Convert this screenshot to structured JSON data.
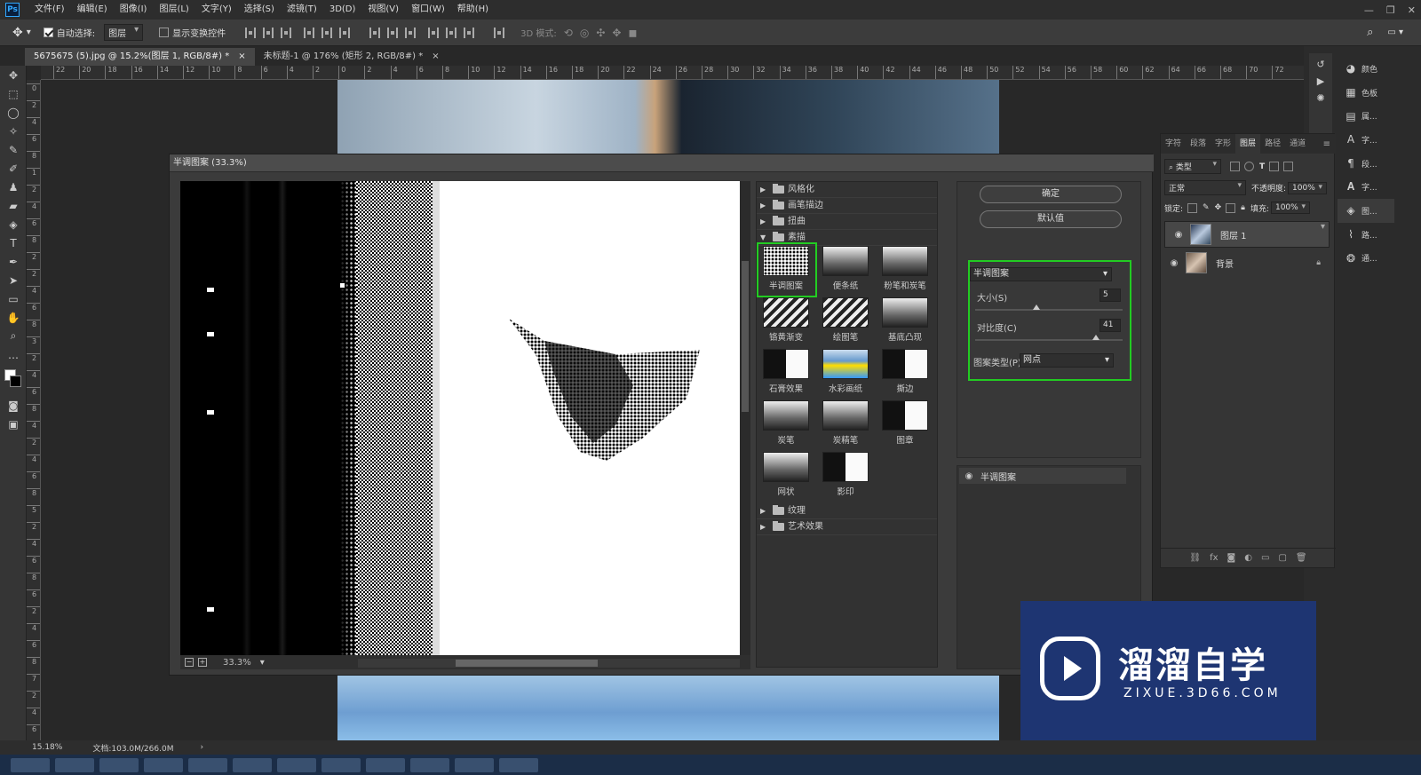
{
  "app": {
    "logo": "Ps"
  },
  "menu": [
    "文件(F)",
    "编辑(E)",
    "图像(I)",
    "图层(L)",
    "文字(Y)",
    "选择(S)",
    "滤镜(T)",
    "3D(D)",
    "视图(V)",
    "窗口(W)",
    "帮助(H)"
  ],
  "options": {
    "auto_select_label": "自动选择:",
    "auto_select_value": "图层",
    "show_transform_label": "显示变换控件",
    "mode_3d_label": "3D 模式:"
  },
  "tabs": [
    {
      "label": "5675675 (5).jpg @ 15.2%(图层 1, RGB/8#) *",
      "close": "×"
    },
    {
      "label": "未标题-1 @ 176% (矩形 2, RGB/8#) *",
      "close": "×"
    }
  ],
  "ruler_h": [
    "22",
    "20",
    "18",
    "16",
    "14",
    "12",
    "10",
    "8",
    "6",
    "4",
    "2",
    "0",
    "2",
    "4",
    "6",
    "8",
    "10",
    "12",
    "14",
    "16",
    "18",
    "20",
    "22",
    "24",
    "26",
    "28",
    "30",
    "32",
    "34",
    "36",
    "38",
    "40",
    "42",
    "44",
    "46",
    "48",
    "50",
    "52",
    "54",
    "56",
    "58",
    "60",
    "62",
    "64",
    "66",
    "68",
    "70",
    "72"
  ],
  "ruler_v": [
    "0",
    "2",
    "4",
    "6",
    "8",
    "1",
    "2",
    "4",
    "6",
    "8",
    "2",
    "2",
    "4",
    "6",
    "8",
    "3",
    "2",
    "4",
    "6",
    "8",
    "4",
    "2",
    "4",
    "6",
    "8",
    "5",
    "2",
    "4",
    "6",
    "8",
    "6",
    "2",
    "4",
    "6",
    "8",
    "7",
    "2",
    "4",
    "6"
  ],
  "dialog": {
    "title": "半调图案 (33.3%)",
    "zoom": "33.3%",
    "ok_label": "确定",
    "default_label": "默认值",
    "categories_top": [
      "风格化",
      "画笔描边",
      "扭曲",
      "素描"
    ],
    "categories_bottom": [
      "纹理",
      "艺术效果"
    ],
    "filters": [
      "半调图案",
      "便条纸",
      "粉笔和炭笔",
      "铬黄渐变",
      "绘图笔",
      "基底凸现",
      "石膏效果",
      "水彩画纸",
      "撕边",
      "炭笔",
      "炭精笔",
      "图章",
      "网状",
      "影印"
    ],
    "selected_filter": "半调图案",
    "size_label": "大小(S)",
    "size_value": "5",
    "size_max": 12,
    "contrast_label": "对比度(C)",
    "contrast_value": "41",
    "contrast_max": 50,
    "pattern_type_label": "图案类型(P):",
    "pattern_type_value": "网点",
    "layer_effect": "半调图案"
  },
  "dock": [
    "颜色",
    "色板",
    "属...",
    "字...",
    "段...",
    "字...",
    "图...",
    "路...",
    "通..."
  ],
  "layers_panel": {
    "tabs": [
      "字符",
      "段落",
      "字形",
      "图层",
      "路径",
      "通道"
    ],
    "filter": "类型",
    "blend_mode": "正常",
    "opacity_label": "不透明度:",
    "opacity": "100%",
    "lock_label": "锁定:",
    "fill_label": "填充:",
    "fill": "100%",
    "layers": [
      {
        "name": "图层 1"
      },
      {
        "name": "背景"
      }
    ]
  },
  "watermark": {
    "cn": "溜溜自学",
    "en": "ZIXUE.3D66.COM"
  },
  "status": {
    "zoom": "15.18%",
    "doc": "文档:103.0M/266.0M"
  }
}
